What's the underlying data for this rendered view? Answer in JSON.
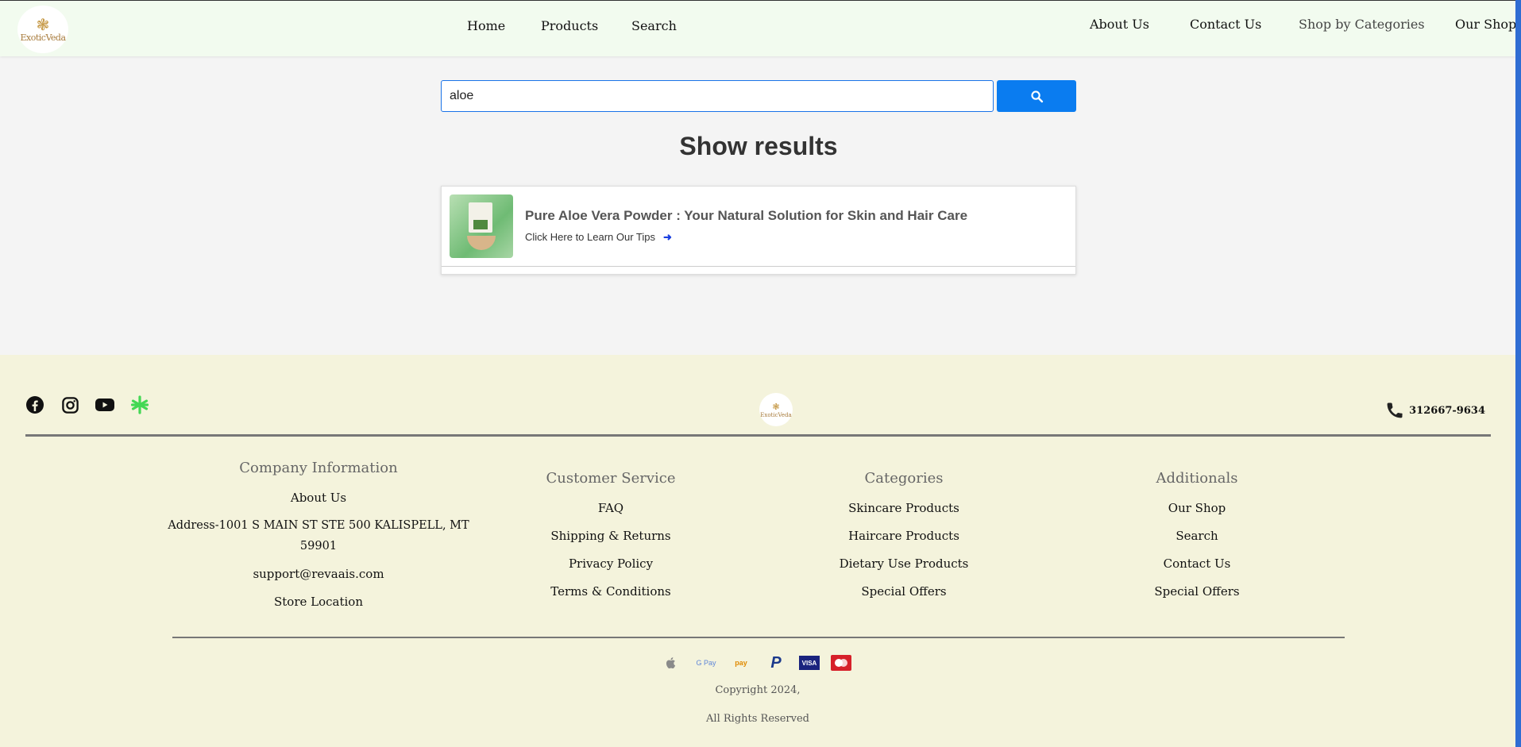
{
  "header": {
    "logo_text": "ExoticVeda",
    "nav_left": [
      "Home",
      "Products",
      "Search"
    ],
    "nav_right": [
      "About Us",
      "Contact Us",
      "Shop by Categories",
      "Our Shop"
    ]
  },
  "search": {
    "value": "aloe",
    "button_icon": "search-icon"
  },
  "results": {
    "title": "Show results",
    "items": [
      {
        "title": "Pure Aloe Vera Powder : Your Natural Solution for Skin and Hair Care",
        "link_text": "Click Here to Learn Our Tips",
        "link_icon": "arrow-right-icon"
      }
    ]
  },
  "footer": {
    "social_icons": [
      "facebook-icon",
      "instagram-icon",
      "youtube-icon",
      "linktree-icon"
    ],
    "logo_text": "ExoticVeda",
    "phone": "312667-9634",
    "columns": [
      {
        "heading": "Company Information",
        "items": [
          "About Us",
          "Address-1001 S MAIN ST STE 500 KALISPELL, MT 59901",
          "support@revaais.com",
          "Store Location"
        ]
      },
      {
        "heading": "Customer Service",
        "items": [
          "FAQ",
          "Shipping & Returns",
          "Privacy Policy",
          "Terms & Conditions"
        ]
      },
      {
        "heading": "Categories",
        "items": [
          "Skincare Products",
          "Haircare Products",
          "Dietary Use Products",
          "Special Offers"
        ]
      },
      {
        "heading": "Additionals",
        "items": [
          "Our Shop",
          "Search",
          "Contact Us",
          "Special Offers"
        ]
      }
    ],
    "payment_labels": {
      "gpay": "G Pay",
      "amazon": "pay",
      "paypal": "P",
      "visa": "VISA"
    },
    "payment_icons": [
      "apple-pay-icon",
      "google-pay-icon",
      "amazon-pay-icon",
      "paypal-icon",
      "visa-icon",
      "mastercard-icon"
    ],
    "copyright": "Copyright 2024,",
    "rights": "All Rights Reserved"
  },
  "colors": {
    "header_bg": "#f2fbef",
    "footer_bg": "#f4f3dc",
    "search_button": "#0a7cf0",
    "accent_bar": "#2f6dd3"
  }
}
